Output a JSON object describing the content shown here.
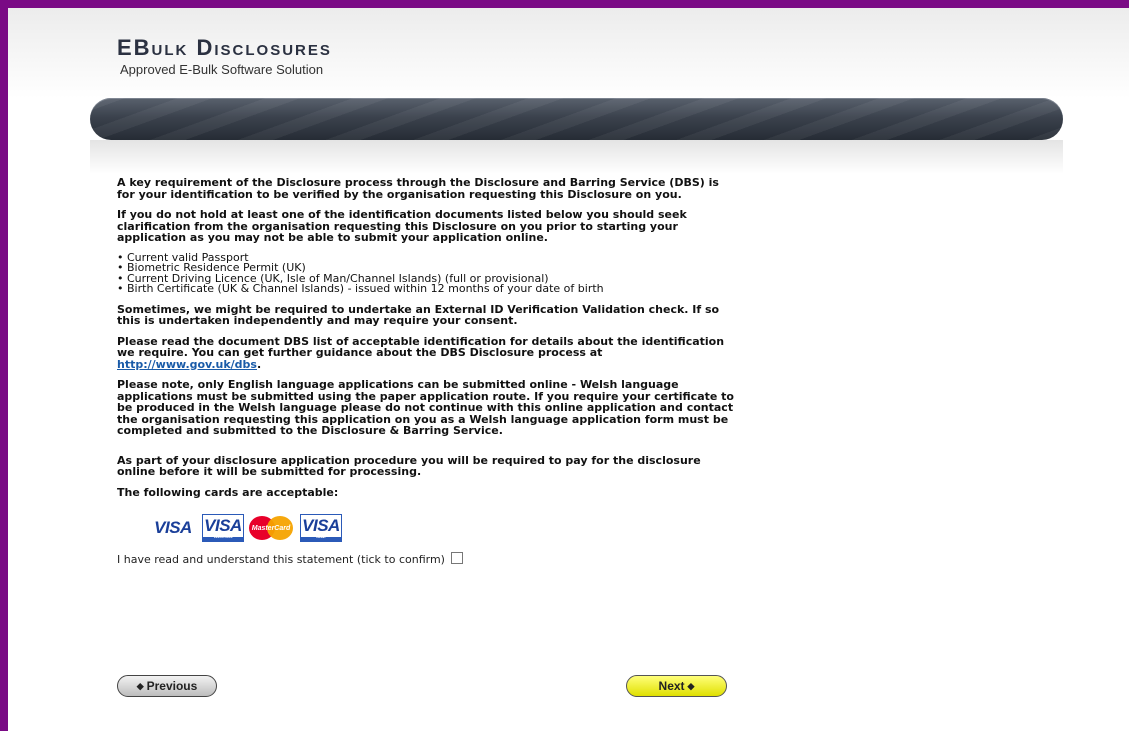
{
  "brand": {
    "title": "EBulk Disclosures",
    "subtitle": "Approved E-Bulk Software Solution"
  },
  "content": {
    "para1": "A key requirement of the Disclosure process through the Disclosure and Barring Service (DBS) is for your identification to be verified by the organisation requesting this Disclosure on you.",
    "para2": "If you do not hold at least one of the identification documents listed below you should seek clarification from the organisation requesting this Disclosure on you prior to starting your application as you may not be able to submit your application online.",
    "id_documents": [
      "Current valid Passport",
      "Biometric Residence Permit (UK)",
      "Current Driving Licence (UK, Isle of Man/Channel Islands) (full or provisional)",
      "Birth Certificate (UK & Channel Islands) - issued within 12 months of your date of birth"
    ],
    "para3": "Sometimes, we might be required to undertake an External ID Verification Validation check. If so this is undertaken independently and may require your consent.",
    "para4_before_link": "Please read the document DBS list of acceptable identification for details about the identification we require. You can get further guidance about the DBS Disclosure process at ",
    "para4_link": "http://www.gov.uk/dbs",
    "para4_after_link": ".",
    "para5": "Please note, only English language applications can be submitted online - Welsh language applications must be submitted using the paper application route. If you require your certificate to be produced in the Welsh language please do not continue with this online application and contact the organisation requesting this application on you as a Welsh language application form must be completed and submitted to the Disclosure & Barring Service.",
    "para6": "As part of your disclosure application procedure you will be required to pay for the disclosure online before it will be submitted for processing.",
    "cards_heading": "The following cards are acceptable:",
    "cards": {
      "visa": "VISA",
      "visa_electron": "VISA",
      "visa_electron_small": "ELECTRON",
      "mastercard": "MasterCard",
      "visa_debit": "VISA",
      "visa_debit_small": "DEBIT"
    },
    "confirm_label": "I have read and understand this statement (tick to confirm)",
    "confirm_checked": false
  },
  "buttons": {
    "previous": "Previous",
    "next": "Next",
    "prev_arrow": "◆",
    "next_arrow": "◆"
  },
  "colors": {
    "frame": "#7a0a85",
    "next_button": "#f0f000",
    "link": "#1a5ba8"
  }
}
